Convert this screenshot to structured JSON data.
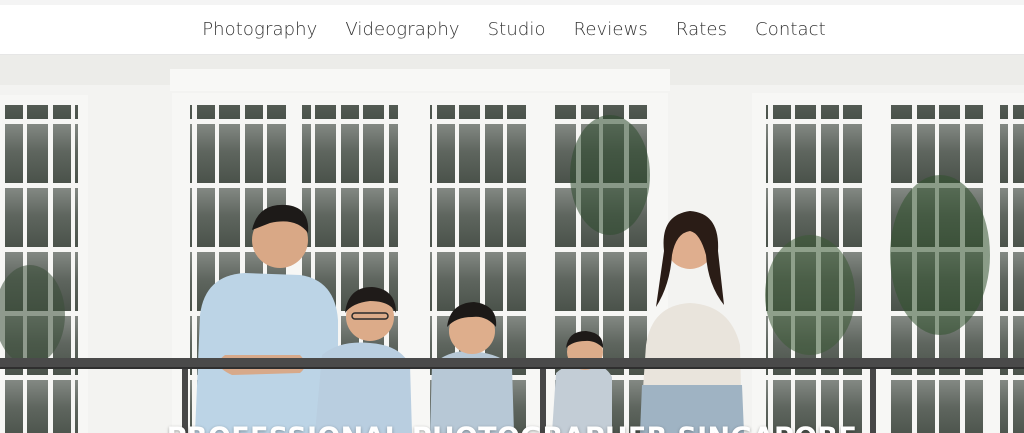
{
  "nav": {
    "items": [
      {
        "label": "Photography"
      },
      {
        "label": "Videography"
      },
      {
        "label": "Studio"
      },
      {
        "label": "Reviews"
      },
      {
        "label": "Rates"
      },
      {
        "label": "Contact"
      }
    ]
  },
  "hero": {
    "title": "PROFESSIONAL PHOTOGRAPHER SINGAPORE"
  },
  "colors": {
    "nav_text": "#333333",
    "hero_title": "#ffffff",
    "wall": "#f3f3f1",
    "window_glass": "#6f746e",
    "railing": "#4a4a4a"
  }
}
